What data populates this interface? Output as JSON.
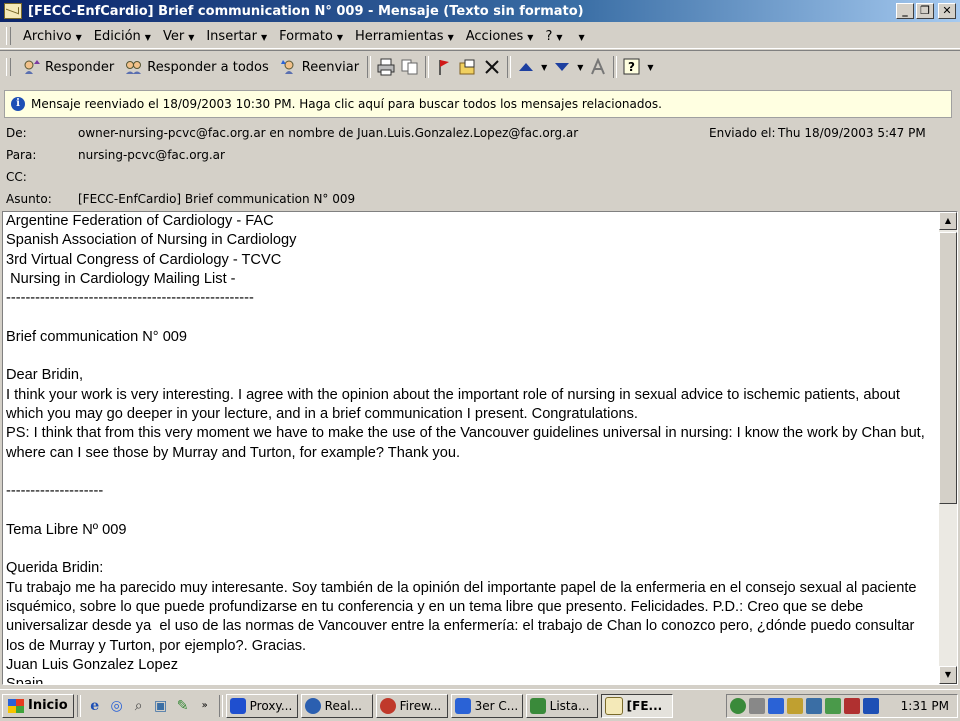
{
  "window": {
    "title": "[FECC-EnfCardio] Brief communication N° 009 - Mensaje (Texto sin formato)",
    "buttons": {
      "minimize": "_",
      "maximize": "❐",
      "close": "✕"
    }
  },
  "menu": [
    {
      "label": "Archivo"
    },
    {
      "label": "Edición"
    },
    {
      "label": "Ver"
    },
    {
      "label": "Insertar"
    },
    {
      "label": "Formato"
    },
    {
      "label": "Herramientas"
    },
    {
      "label": "Acciones"
    },
    {
      "label": "?"
    }
  ],
  "toolbar": {
    "reply": "Responder",
    "reply_all": "Responder a todos",
    "forward": "Reenviar"
  },
  "infobar": {
    "text": "Mensaje reenviado el 18/09/2003 10:30 PM. Haga clic aquí para buscar todos los mensajes relacionados."
  },
  "header": {
    "from_label": "De:",
    "from_value": "owner-nursing-pcvc@fac.org.ar en nombre de Juan.Luis.Gonzalez.Lopez@fac.org.ar",
    "sent_label": "Enviado el:",
    "sent_value": "Thu 18/09/2003 5:47 PM",
    "to_label": "Para:",
    "to_value": "nursing-pcvc@fac.org.ar",
    "cc_label": "CC:",
    "cc_value": "",
    "subject_label": "Asunto:",
    "subject_value": "[FECC-EnfCardio] Brief communication N° 009"
  },
  "body": {
    "text": "Argentine Federation of Cardiology - FAC\nSpanish Association of Nursing in Cardiology\n3rd Virtual Congress of Cardiology - TCVC\n Nursing in Cardiology Mailing List -\n---------------------------------------------------\n\nBrief communication N° 009\n\nDear Bridin,\nI think your work is very interesting. I agree with the opinion about the important role of nursing in sexual advice to ischemic patients, about which you may go deeper in your lecture, and in a brief communication I present. Congratulations.\nPS: I think that from this very moment we have to make the use of the Vancouver guidelines universal in nursing: I know the work by Chan but, where can I see those by Murray and Turton, for example? Thank you.\n\n--------------------\n\nTema Libre Nº 009\n\nQuerida Bridin:\nTu trabajo me ha parecido muy interesante. Soy también de la opinión del importante papel de la enfermeria en el consejo sexual al paciente isquémico, sobre lo que puede profundizarse en tu conferencia y en un tema libre que presento. Felicidades. P.D.: Creo que se debe universalizar desde ya  el uso de las normas de Vancouver entre la enfermería: el trabajo de Chan lo conozco pero, ¿dónde puedo consultar los de Murray y Turton, por ejemplo?. Gracias.\nJuan Luis Gonzalez Lopez\nSpain"
  },
  "taskbar": {
    "start": "Inicio",
    "tasks": [
      {
        "label": "Proxy...",
        "color": "#1f4fcf"
      },
      {
        "label": "Real...",
        "color": "#2b5fb0"
      },
      {
        "label": "Firew...",
        "color": "#c0392b"
      },
      {
        "label": "3er C...",
        "color": "#2a62d6"
      },
      {
        "label": "Lista...",
        "color": "#3a8a3a"
      },
      {
        "label": "[FE...",
        "color": "#d9c36a"
      }
    ],
    "clock": "1:31 PM"
  }
}
